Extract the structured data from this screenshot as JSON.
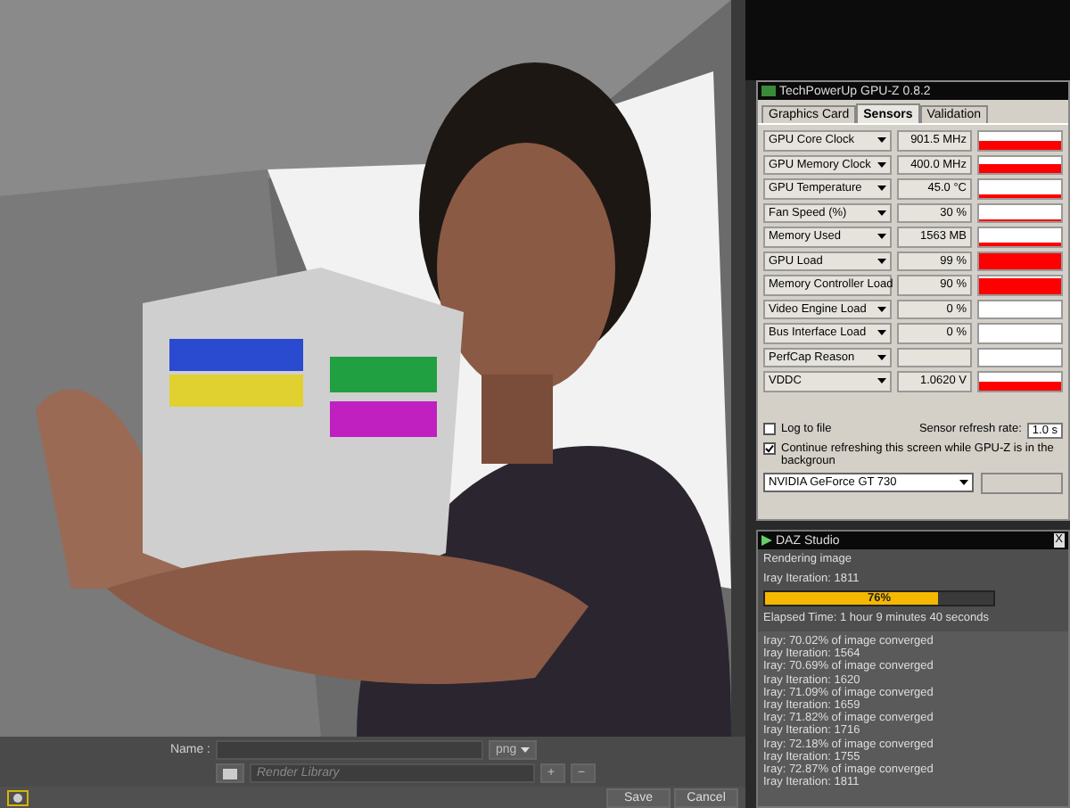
{
  "render_window": {
    "picture": {
      "kind": "picture"
    },
    "name_label": "Name :",
    "format": "png",
    "library": {
      "placeholder": "Render Library"
    },
    "add": "+",
    "remove": "−",
    "buttons": [
      "Save",
      "Cancel"
    ]
  },
  "gpuz": {
    "title": "TechPowerUp GPU-Z 0.8.2",
    "tabs": [
      {
        "label": "Graphics Card",
        "selected": false
      },
      {
        "label": "Sensors",
        "selected": true
      },
      {
        "label": "Validation",
        "selected": false
      }
    ],
    "sensors": [
      {
        "name": "GPU Core Clock",
        "value": "901.5 MHz",
        "kind": "mid"
      },
      {
        "name": "GPU Memory Clock",
        "value": "400.0 MHz",
        "kind": "mid"
      },
      {
        "name": "GPU Temperature",
        "value": "45.0 °C",
        "kind": "low"
      },
      {
        "name": "Fan Speed (%)",
        "value": "30 %",
        "kind": "low"
      },
      {
        "name": "Memory Used",
        "value": "1563 MB",
        "kind": "low"
      },
      {
        "name": "GPU Load",
        "value": "99 %",
        "kind": "high"
      },
      {
        "name": "Memory Controller Load",
        "value": "90 %",
        "kind": "high"
      },
      {
        "name": "Video Engine Load",
        "value": "0 %",
        "kind": "empty"
      },
      {
        "name": "Bus Interface Load",
        "value": "0 %",
        "kind": "empty"
      },
      {
        "name": "PerfCap Reason",
        "kind": "empty"
      },
      {
        "name": "VDDC",
        "value": "1.0620 V",
        "kind": "mid"
      }
    ],
    "log_to_file": {
      "label": "Log to file",
      "checked": false
    },
    "refresh_label": "Sensor refresh rate:",
    "refresh_value": "1.0 s",
    "continue": {
      "label": "Continue refreshing this screen while GPU-Z is in the backgroun",
      "checked": true
    },
    "device": "NVIDIA GeForce GT 730"
  },
  "daz": {
    "title": "DAZ Studio",
    "close": "X",
    "status": "Rendering image",
    "iteration": "Iray Iteration: 1811",
    "progress": {
      "level": 0.76,
      "label": "76%"
    },
    "elapsed": "Elapsed Time:  1 hour 9 minutes 40 seconds",
    "log": [
      "Iray: 70.02% of image converged",
      "Iray Iteration: 1564",
      "Iray: 70.69% of image converged",
      "Iray Iteration: 1620",
      "Iray: 71.09% of image converged",
      "Iray Iteration: 1659",
      "Iray: 71.82% of image converged",
      "Iray Iteration: 1716",
      "Iray: 72.18% of image converged",
      "Iray Iteration: 1755",
      "Iray: 72.87% of image converged",
      "Iray Iteration: 1811"
    ]
  }
}
